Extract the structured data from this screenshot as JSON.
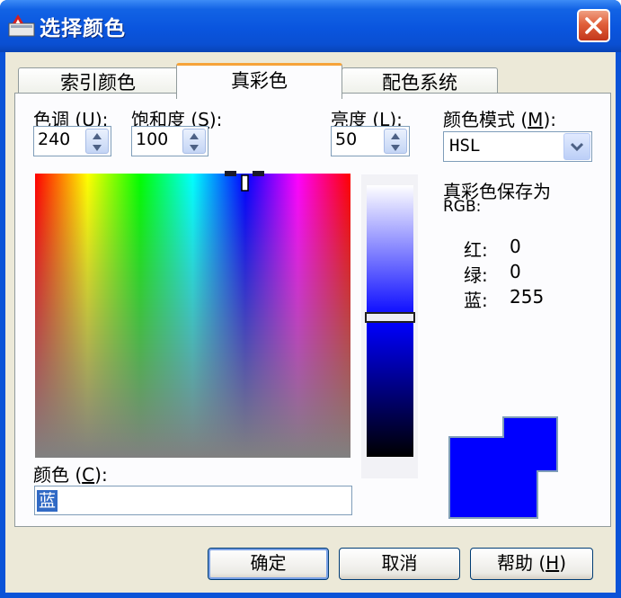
{
  "window": {
    "title": "选择颜色"
  },
  "tabs": [
    {
      "label": "索引颜色"
    },
    {
      "label": "真彩色"
    },
    {
      "label": "配色系统"
    }
  ],
  "hue": {
    "label": "色调",
    "mnemonic": "U",
    "value": "240"
  },
  "saturation": {
    "label": "饱和度",
    "mnemonic": "S",
    "value": "100"
  },
  "luminance": {
    "label": "亮度",
    "mnemonic": "L",
    "value": "50"
  },
  "color_model": {
    "label": "颜色模式",
    "mnemonic": "M",
    "value": "HSL"
  },
  "saved_as": {
    "line1": "真彩色保存为",
    "line2": "RGB:"
  },
  "rgb": [
    {
      "label": "红:",
      "value": "0"
    },
    {
      "label": "绿:",
      "value": "0"
    },
    {
      "label": "蓝:",
      "value": "255"
    }
  ],
  "color_field": {
    "label": "颜色",
    "mnemonic": "C",
    "value": "蓝"
  },
  "buttons": {
    "ok": "确定",
    "cancel": "取消",
    "help": "帮助",
    "help_mnemonic": "H"
  },
  "colors": {
    "current": "#0000ff",
    "previous": "#0000ff",
    "title_bar": "#0a55de",
    "tab_highlight": "#f6a33a"
  },
  "icons": {
    "app": "autocad-logo-icon",
    "close": "close-icon",
    "spin": "spin-updown-icon",
    "dropdown": "chevron-down-icon"
  }
}
